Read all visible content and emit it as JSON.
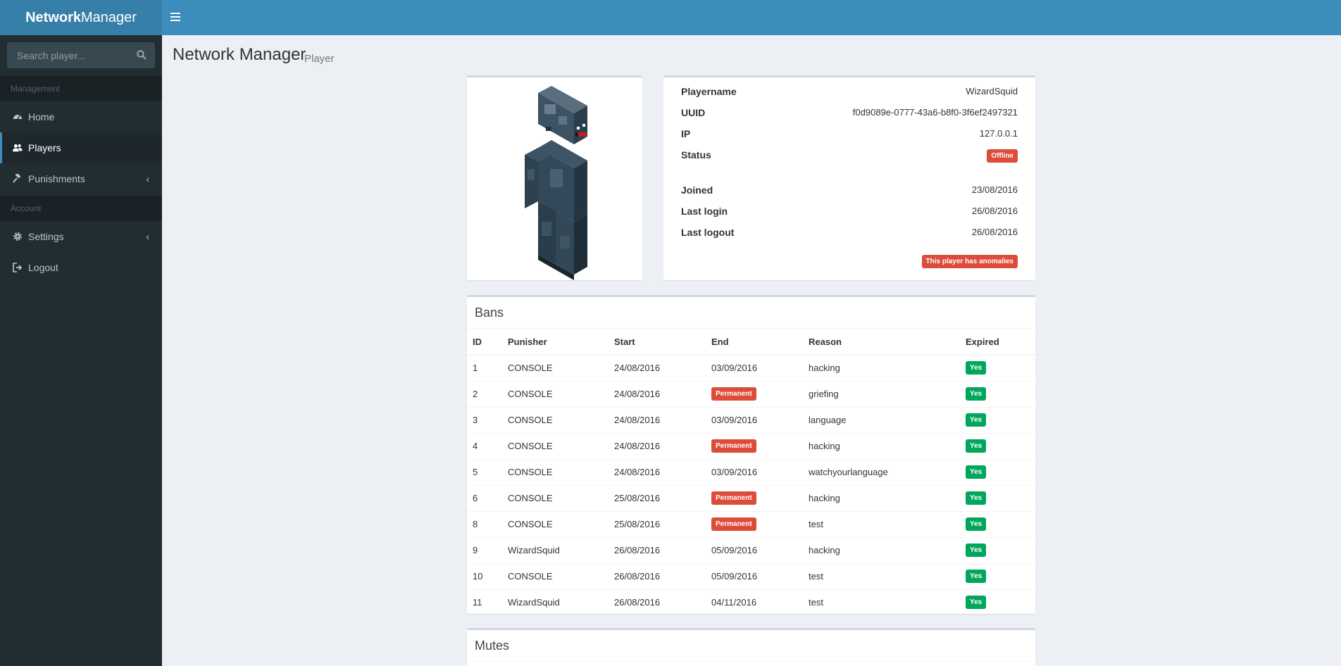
{
  "header": {
    "logo_bold": "Network",
    "logo_light": "Manager"
  },
  "sidebar": {
    "search_placeholder": "Search player...",
    "sections": [
      {
        "title": "Management"
      },
      {
        "title": "Account"
      }
    ],
    "items": [
      {
        "label": "Home",
        "icon": "dashboard-icon"
      },
      {
        "label": "Players",
        "icon": "users-icon"
      },
      {
        "label": "Punishments",
        "icon": "gavel-icon"
      },
      {
        "label": "Settings",
        "icon": "gear-icon"
      },
      {
        "label": "Logout",
        "icon": "sign-out-icon"
      }
    ]
  },
  "page": {
    "title": "Network Manager",
    "subtitle": "Player"
  },
  "player": {
    "rows": [
      {
        "label": "Playername",
        "value": "WizardSquid"
      },
      {
        "label": "UUID",
        "value": "f0d9089e-0777-43a6-b8f0-3f6ef2497321"
      },
      {
        "label": "IP",
        "value": "127.0.0.1"
      },
      {
        "label": "Status",
        "value": "Offline"
      },
      {
        "label": "Joined",
        "value": "23/08/2016"
      },
      {
        "label": "Last login",
        "value": "26/08/2016"
      },
      {
        "label": "Last logout",
        "value": "26/08/2016"
      }
    ],
    "anomaly_badge": "This player has anomalies"
  },
  "bans": {
    "title": "Bans",
    "columns": [
      "ID",
      "Punisher",
      "Start",
      "End",
      "Reason",
      "Expired"
    ],
    "rows": [
      {
        "id": "1",
        "punisher": "CONSOLE",
        "start": "24/08/2016",
        "end": "03/09/2016",
        "reason": "hacking",
        "expired": "Yes"
      },
      {
        "id": "2",
        "punisher": "CONSOLE",
        "start": "24/08/2016",
        "end": "Permanent",
        "reason": "griefing",
        "expired": "Yes"
      },
      {
        "id": "3",
        "punisher": "CONSOLE",
        "start": "24/08/2016",
        "end": "03/09/2016",
        "reason": "language",
        "expired": "Yes"
      },
      {
        "id": "4",
        "punisher": "CONSOLE",
        "start": "24/08/2016",
        "end": "Permanent",
        "reason": "hacking",
        "expired": "Yes"
      },
      {
        "id": "5",
        "punisher": "CONSOLE",
        "start": "24/08/2016",
        "end": "03/09/2016",
        "reason": "watchyourlanguage",
        "expired": "Yes"
      },
      {
        "id": "6",
        "punisher": "CONSOLE",
        "start": "25/08/2016",
        "end": "Permanent",
        "reason": "hacking",
        "expired": "Yes"
      },
      {
        "id": "8",
        "punisher": "CONSOLE",
        "start": "25/08/2016",
        "end": "Permanent",
        "reason": "test",
        "expired": "Yes"
      },
      {
        "id": "9",
        "punisher": "WizardSquid",
        "start": "26/08/2016",
        "end": "05/09/2016",
        "reason": "hacking",
        "expired": "Yes"
      },
      {
        "id": "10",
        "punisher": "CONSOLE",
        "start": "26/08/2016",
        "end": "05/09/2016",
        "reason": "test",
        "expired": "Yes"
      },
      {
        "id": "11",
        "punisher": "WizardSquid",
        "start": "26/08/2016",
        "end": "04/11/2016",
        "reason": "test",
        "expired": "Yes"
      }
    ]
  },
  "mutes": {
    "title": "Mutes"
  },
  "colors": {
    "header": "#3c8dbc",
    "logo_bg": "#367fa9",
    "sidebar": "#222d32",
    "danger": "#dd4b39",
    "success": "#00a65a"
  }
}
